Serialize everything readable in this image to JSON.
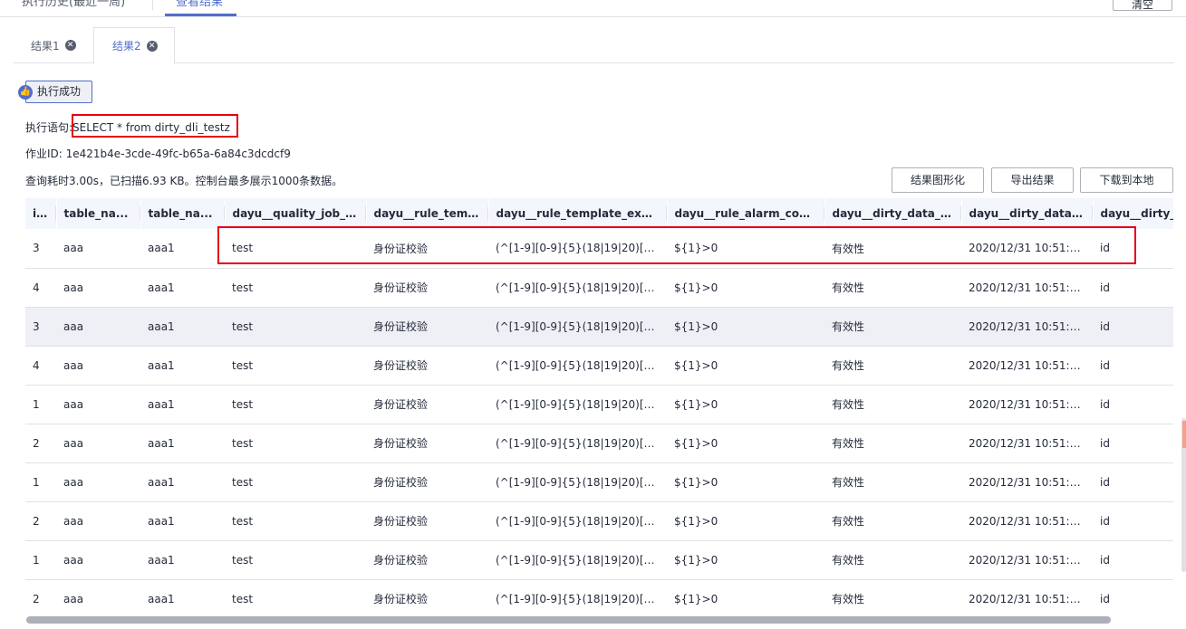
{
  "top_tabs": {
    "history_label": "执行历史(最近一周)",
    "results_label": "查看结果",
    "clear_label": "清空"
  },
  "result_tabs": [
    {
      "label": "结果1"
    },
    {
      "label": "结果2"
    }
  ],
  "status": {
    "label": "执行成功"
  },
  "info": {
    "sql_prefix": "执行语句:",
    "sql": "SELECT * from dirty_dli_testz",
    "job_id": "作业ID: 1e421b4e-3cde-49fc-b65a-6a84c3dcdcf9",
    "summary": "查询耗时3.00s，已扫描6.93 KB。控制台最多展示1000条数据。"
  },
  "actions": {
    "chart_label": "结果图形化",
    "export_label": "导出结果",
    "download_label": "下载到本地"
  },
  "table": {
    "headers": [
      "i...",
      "table_na...",
      "table_na...",
      "dayu__quality_job_n...",
      "dayu__rule_temp...",
      "dayu__rule_template_expre...",
      "dayu__rule_alarm_cond...",
      "dayu__dirty_data_st...",
      "dayu__dirty_data_t...",
      "dayu__dirty_d"
    ],
    "rows": [
      [
        "3",
        "aaa",
        "aaa1",
        "test",
        "身份证校验",
        "(^[1-9][0-9]{5}(18|19|20)[0-9]...",
        "${1}>0",
        "有效性",
        "2020/12/31 10:51:1...",
        "id"
      ],
      [
        "4",
        "aaa",
        "aaa1",
        "test",
        "身份证校验",
        "(^[1-9][0-9]{5}(18|19|20)[0-9]...",
        "${1}>0",
        "有效性",
        "2020/12/31 10:51:1...",
        "id"
      ],
      [
        "3",
        "aaa",
        "aaa1",
        "test",
        "身份证校验",
        "(^[1-9][0-9]{5}(18|19|20)[0-9]...",
        "${1}>0",
        "有效性",
        "2020/12/31 10:51:1...",
        "id"
      ],
      [
        "4",
        "aaa",
        "aaa1",
        "test",
        "身份证校验",
        "(^[1-9][0-9]{5}(18|19|20)[0-9]...",
        "${1}>0",
        "有效性",
        "2020/12/31 10:51:1...",
        "id"
      ],
      [
        "1",
        "aaa",
        "aaa1",
        "test",
        "身份证校验",
        "(^[1-9][0-9]{5}(18|19|20)[0-9]...",
        "${1}>0",
        "有效性",
        "2020/12/31 10:51:1...",
        "id"
      ],
      [
        "2",
        "aaa",
        "aaa1",
        "test",
        "身份证校验",
        "(^[1-9][0-9]{5}(18|19|20)[0-9]...",
        "${1}>0",
        "有效性",
        "2020/12/31 10:51:1...",
        "id"
      ],
      [
        "1",
        "aaa",
        "aaa1",
        "test",
        "身份证校验",
        "(^[1-9][0-9]{5}(18|19|20)[0-9]...",
        "${1}>0",
        "有效性",
        "2020/12/31 10:51:1...",
        "id"
      ],
      [
        "2",
        "aaa",
        "aaa1",
        "test",
        "身份证校验",
        "(^[1-9][0-9]{5}(18|19|20)[0-9]...",
        "${1}>0",
        "有效性",
        "2020/12/31 10:51:1...",
        "id"
      ],
      [
        "1",
        "aaa",
        "aaa1",
        "test",
        "身份证校验",
        "(^[1-9][0-9]{5}(18|19|20)[0-9]...",
        "${1}>0",
        "有效性",
        "2020/12/31 10:51:1...",
        "id"
      ],
      [
        "2",
        "aaa",
        "aaa1",
        "test",
        "身份证校验",
        "(^[1-9][0-9]{5}(18|19|20)[0-9]...",
        "${1}>0",
        "有效性",
        "2020/12/31 10:51:1...",
        "id"
      ]
    ]
  }
}
